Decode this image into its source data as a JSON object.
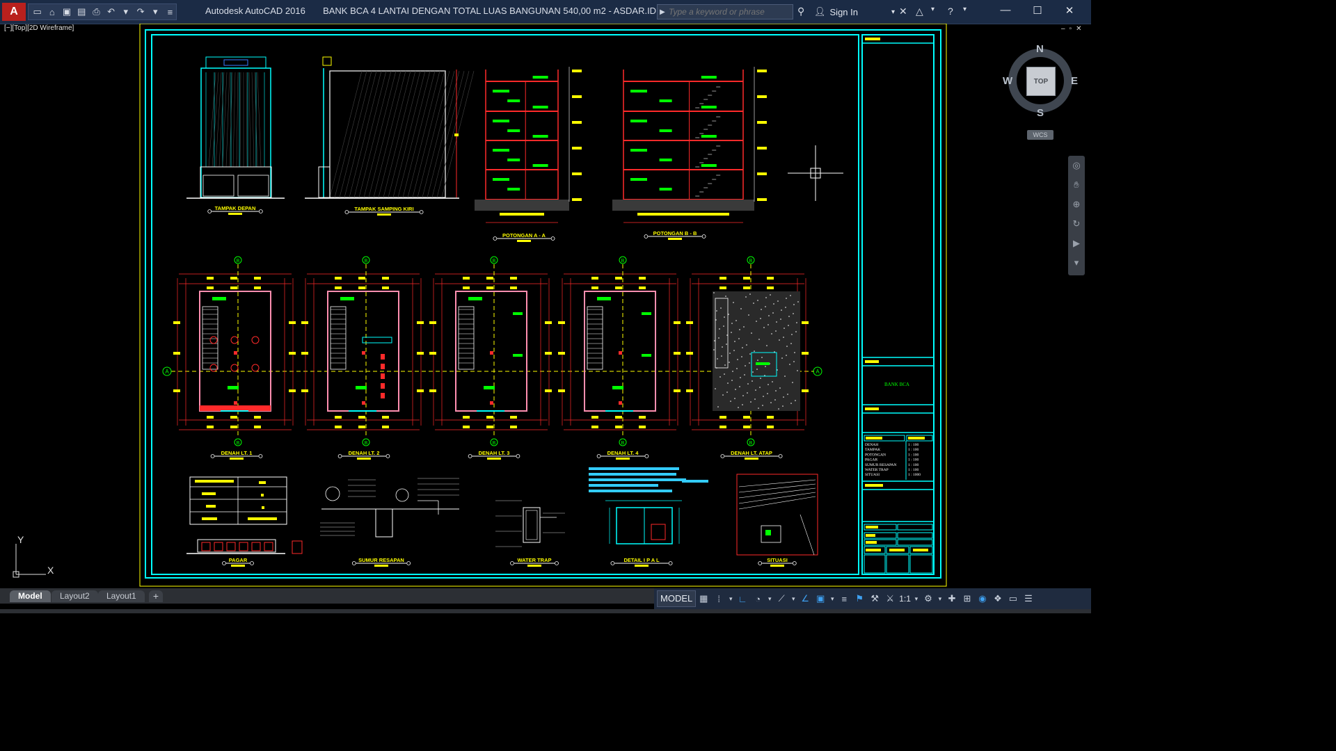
{
  "app": {
    "title": "Autodesk AutoCAD 2016",
    "document": "BANK BCA 4 LANTAI DENGAN TOTAL LUAS BANGUNAN 540,00 m2 - ASDAR.ID.dwg",
    "logo_letter": "A"
  },
  "search": {
    "placeholder": "Type a keyword or phrase"
  },
  "account": {
    "sign_in": "Sign In"
  },
  "viewport": {
    "label": "[−][Top][2D Wireframe]"
  },
  "navigation": {
    "compass": {
      "north": "N",
      "south": "S",
      "east": "E",
      "west": "W",
      "top": "TOP"
    },
    "wcs": "WCS"
  },
  "ucs": {
    "x": "X",
    "y": "Y"
  },
  "tabs": {
    "model": "Model",
    "layout2": "Layout2",
    "layout1": "Layout1",
    "add": "+"
  },
  "status": {
    "model": "MODEL",
    "scale": "1:1"
  },
  "sheet": {
    "drawings": [
      "TAMPAK DEPAN",
      "TAMPAK SAMPING KIRI",
      "POTONGAN A - A",
      "POTONGAN B - B",
      "DENAH LT. 1",
      "DENAH LT. 2",
      "DENAH LT. 3",
      "DENAH LT. 4",
      "DENAH LT. ATAP",
      "PAGAR",
      "SUMUR RESAPAN",
      "WATER TRAP",
      "DETAIL I P A L",
      "SITUASI"
    ],
    "grid_markers": [
      "A",
      "B"
    ],
    "title_block": {
      "project": "BANK BCA",
      "sheet_list": [
        "DENAH",
        "TAMPAK",
        "POTONGAN",
        "PAGAR",
        "SUMUR RESAPAN",
        "WATER TRAP",
        "SITUASI"
      ],
      "scales": [
        "1 : 100",
        "1 : 100",
        "1 : 100",
        "1 : 100",
        "1 : 100",
        "1 : 100",
        "1 : 1000"
      ]
    }
  },
  "colors": {
    "cyan": "#00ffff",
    "yellow": "#ffff00",
    "green": "#00ff00",
    "red": "#ff2a2a",
    "white": "#ffffff",
    "titlebar": "#1b2b45"
  }
}
